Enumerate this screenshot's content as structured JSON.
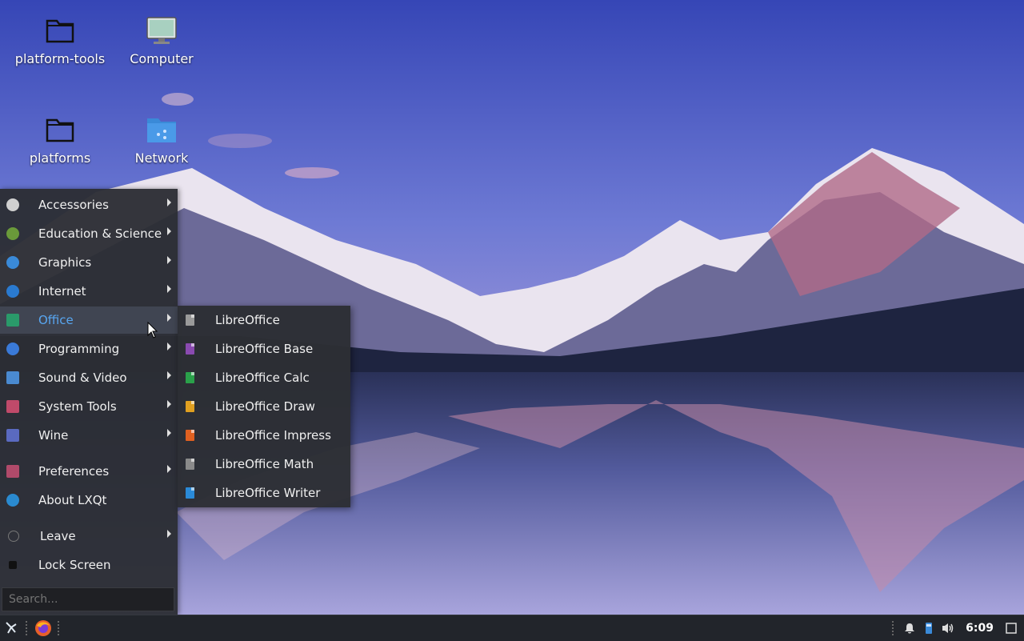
{
  "desktop": {
    "icons": [
      {
        "label": "platform-tools",
        "icon": "folder-icon"
      },
      {
        "label": "Computer",
        "icon": "computer-icon"
      },
      {
        "label": "platforms",
        "icon": "folder-icon"
      },
      {
        "label": "Network",
        "icon": "network-folder-icon"
      }
    ]
  },
  "menu": {
    "items": [
      {
        "label": "Accessories",
        "icon": "accessories-icon",
        "color": "#d0d0d0",
        "submenu": true
      },
      {
        "label": "Education & Science",
        "icon": "education-icon",
        "color": "#6a9a3a",
        "submenu": true
      },
      {
        "label": "Graphics",
        "icon": "graphics-icon",
        "color": "#3a8ad8",
        "submenu": true
      },
      {
        "label": "Internet",
        "icon": "internet-icon",
        "color": "#2a7ad0",
        "submenu": true
      },
      {
        "label": "Office",
        "icon": "office-icon",
        "color": "#2a9a6a",
        "submenu": true
      },
      {
        "label": "Programming",
        "icon": "programming-icon",
        "color": "#3a7ad8",
        "submenu": true
      },
      {
        "label": "Sound & Video",
        "icon": "sound-video-icon",
        "color": "#4a8ad0",
        "submenu": true
      },
      {
        "label": "System Tools",
        "icon": "system-tools-icon",
        "color": "#c04a6a",
        "submenu": true
      },
      {
        "label": "Wine",
        "icon": "wine-icon",
        "color": "#5a6ac0",
        "submenu": true
      },
      {
        "label": "Preferences",
        "icon": "preferences-icon",
        "color": "#b04a6a",
        "submenu": true
      },
      {
        "label": "About LXQt",
        "icon": "lxqt-icon",
        "color": "#2a8ad0",
        "submenu": false
      },
      {
        "label": "Leave",
        "icon": "power-icon",
        "color": "#555555",
        "submenu": true
      },
      {
        "label": "Lock Screen",
        "icon": "lock-icon",
        "color": "#333333",
        "submenu": false
      }
    ],
    "active": "Office",
    "search_placeholder": "Search..."
  },
  "submenu": {
    "items": [
      {
        "label": "LibreOffice",
        "color": "#9a9a9a"
      },
      {
        "label": "LibreOffice Base",
        "color": "#8a4ab0"
      },
      {
        "label": "LibreOffice Calc",
        "color": "#2aa04a"
      },
      {
        "label": "LibreOffice Draw",
        "color": "#e0a020"
      },
      {
        "label": "LibreOffice Impress",
        "color": "#e06020"
      },
      {
        "label": "LibreOffice Math",
        "color": "#8a8a8a"
      },
      {
        "label": "LibreOffice Writer",
        "color": "#2a8ad8"
      }
    ]
  },
  "taskbar": {
    "clock": "6:09",
    "launchers": [
      "lxqt-menu-icon",
      "firefox-icon"
    ],
    "tray": [
      "notification-bell-icon",
      "usb-drive-icon",
      "volume-icon",
      "show-desktop-icon"
    ]
  }
}
